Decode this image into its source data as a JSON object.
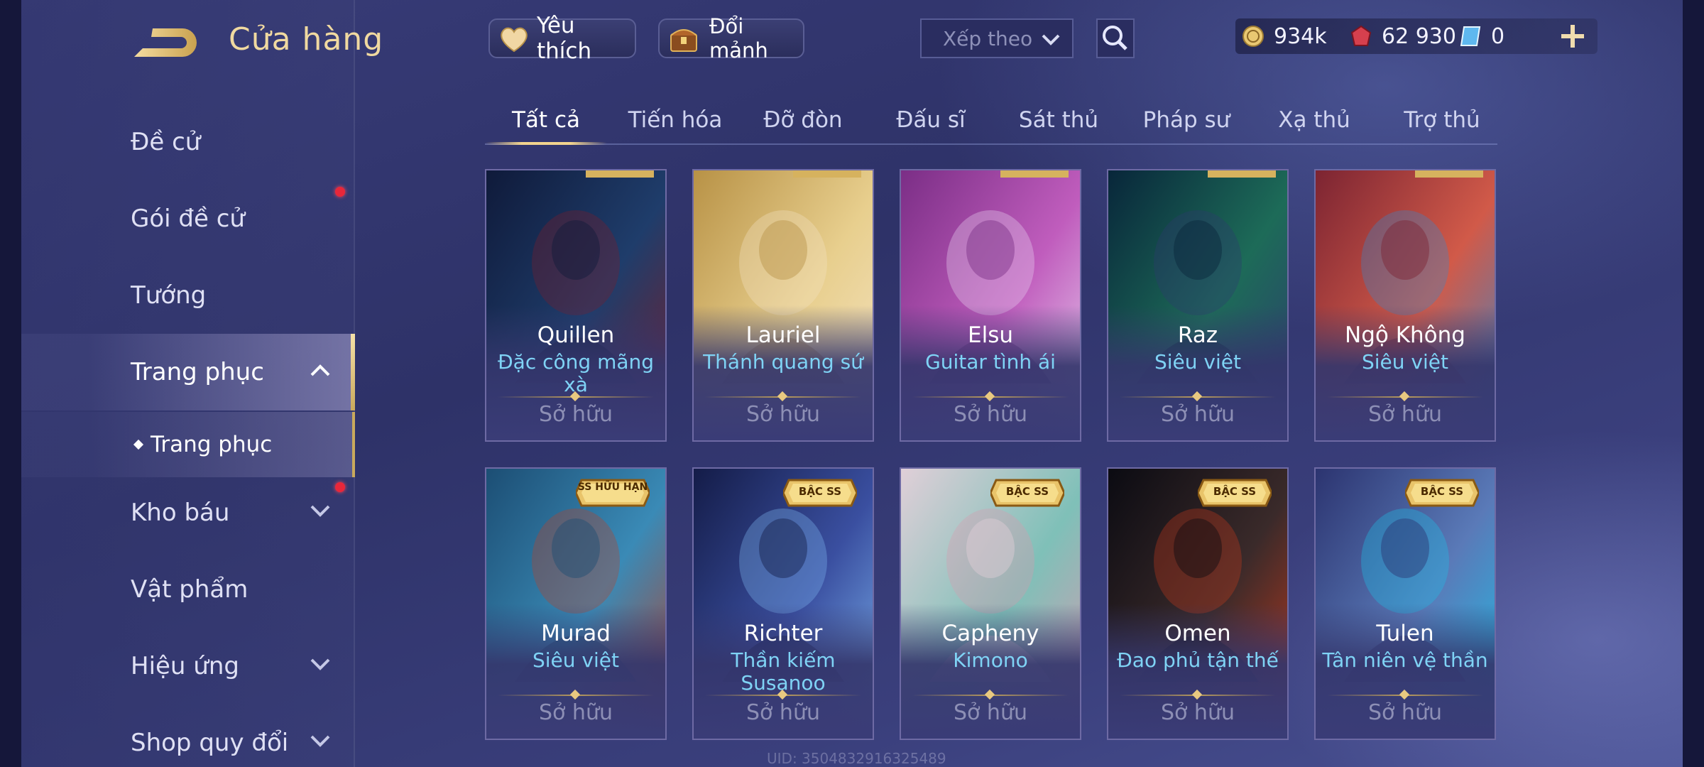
{
  "header": {
    "title": "Cửa hàng",
    "favorite_label": "Yêu thích",
    "shard_label": "Đổi mảnh",
    "sort_placeholder": "Xếp theo",
    "currencies": [
      {
        "name": "gold-coin",
        "value": "934k"
      },
      {
        "name": "ruby-voucher",
        "value": "62 930"
      },
      {
        "name": "blue-ticket",
        "value": "0"
      }
    ]
  },
  "sidebar": {
    "items": [
      {
        "label": "Đề cử"
      },
      {
        "label": "Gói đề cử"
      },
      {
        "label": "Tướng"
      },
      {
        "label": "Trang phục"
      },
      {
        "label": "Kho báu"
      },
      {
        "label": "Vật phẩm"
      },
      {
        "label": "Hiệu ứng"
      },
      {
        "label": "Shop quy đổi"
      }
    ],
    "sub_item": "Trang phục"
  },
  "tabs": [
    "Tất cả",
    "Tiến hóa",
    "Đỡ đòn",
    "Đấu sĩ",
    "Sát thủ",
    "Pháp sư",
    "Xạ thủ",
    "Trợ thủ"
  ],
  "cards": [
    {
      "hero": "Quillen",
      "skin": "Đặc công mãng xà",
      "status": "Sở hữu",
      "colors": [
        "#0f1a3a",
        "#1f3d6b",
        "#7a1e2b"
      ]
    },
    {
      "hero": "Lauriel",
      "skin": "Thánh quang sứ",
      "status": "Sở hữu",
      "colors": [
        "#b89246",
        "#e8cf8e",
        "#f4e3c3"
      ]
    },
    {
      "hero": "Elsu",
      "skin": "Guitar tình ái",
      "status": "Sở hữu",
      "colors": [
        "#7b2e86",
        "#c05dbd",
        "#e8d3f0"
      ]
    },
    {
      "hero": "Raz",
      "skin": "Siêu việt",
      "status": "Sở hữu",
      "colors": [
        "#08263a",
        "#1d6b58",
        "#2e3a70"
      ]
    },
    {
      "hero": "Ngộ Không",
      "skin": "Siêu việt",
      "status": "Sở hữu",
      "colors": [
        "#7c2432",
        "#d15a49",
        "#3a86c8"
      ]
    },
    {
      "hero": "Murad",
      "skin": "Siêu việt",
      "status": "Sở hữu",
      "badge": "SS HỮU HẠN",
      "colors": [
        "#1c4e74",
        "#3a8ab6",
        "#b6412b"
      ]
    },
    {
      "hero": "Richter",
      "skin": "Thần kiếm Susanoo",
      "status": "Sở hữu",
      "badge": "BẬC SS",
      "colors": [
        "#141c48",
        "#3a4fa0",
        "#7fb6f0"
      ]
    },
    {
      "hero": "Capheny",
      "skin": "Kimono",
      "status": "Sở hữu",
      "badge": "BẬC SS",
      "colors": [
        "#e0cfd8",
        "#7fc0b8",
        "#d89ab0"
      ]
    },
    {
      "hero": "Omen",
      "skin": "Đao phủ tận thế",
      "status": "Sở hữu",
      "badge": "BẬC SS",
      "colors": [
        "#0b0b12",
        "#3a2a2a",
        "#c23a1e"
      ]
    },
    {
      "hero": "Tulen",
      "skin": "Tân niên vệ thần",
      "status": "Sở hữu",
      "badge": "BẬC SS",
      "colors": [
        "#2c3470",
        "#5a7ab8",
        "#1ec0e8"
      ]
    }
  ],
  "footer": {
    "uid": "UID: 3504832916325489"
  },
  "colors": {
    "accent_gold": "#f2d48e",
    "skin_name": "#7fd3f5",
    "active_dot": "#e8273a"
  }
}
